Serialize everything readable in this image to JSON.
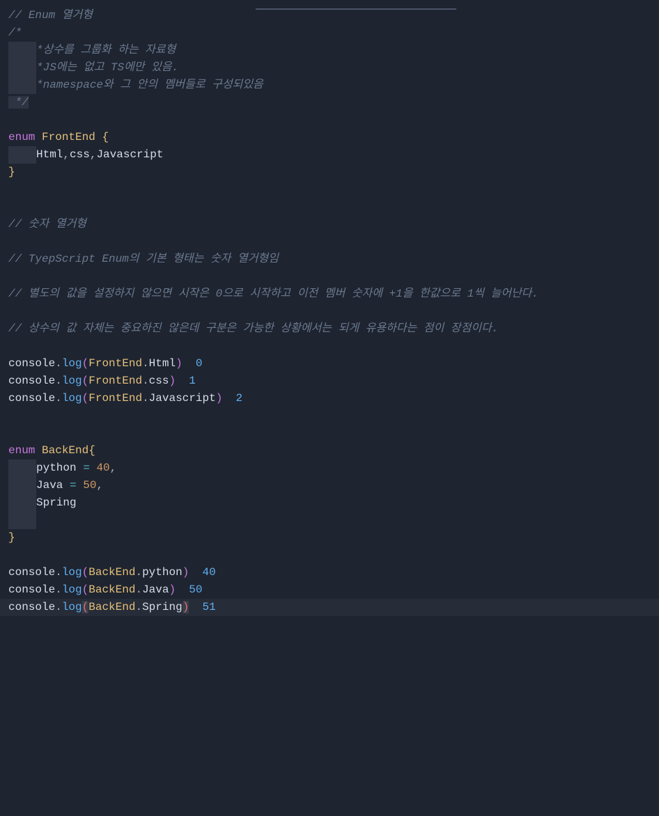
{
  "chart_data": null,
  "code": {
    "c1": "// Enum 열거형",
    "c2": "/*",
    "c3": "*상수를 그룹화 하는 자료형",
    "c4": "*JS에는 없고 TS에만 있음.",
    "c5": "*namespace와 그 안의 멤버들로 구성되있음",
    "c6": " */",
    "kw_enum": "enum",
    "enum1_name": "FrontEnd",
    "brace_open": "{",
    "brace_close": "}",
    "enum1_m1": "Html",
    "enum1_m2": "css",
    "enum1_m3": "Javascript",
    "comma": ",",
    "c7": "// 숫자 열거형",
    "c8": "// TyepScript Enum의 기본 형태는 숫자 열거형임",
    "c9": "// 별도의 값을 설정하지 않으면 시작은 0으로 시작하고 이전 멤버 숫자에 +1을 한값으로 1씩 늘어난다.",
    "c10": "// 상수의 값 자체는 중요하진 않은데 구분은 가능한 상황에서는 되게 유용하다는 점이 장점이다.",
    "console": "console",
    "dot": ".",
    "log": "log",
    "paren_open": "(",
    "paren_close": ")",
    "ref_FrontEnd": "FrontEnd",
    "ref_Html": "Html",
    "ref_css": "css",
    "ref_Javascript": "Javascript",
    "r1": "0",
    "r2": "1",
    "r3": "2",
    "enum2_name": "BackEnd",
    "enum2_m1": "python",
    "enum2_m2": "Java",
    "enum2_m3": "Spring",
    "eq": "=",
    "v40": "40",
    "v50": "50",
    "ref_BackEnd": "BackEnd",
    "ref_python": "python",
    "ref_Java": "Java",
    "ref_Spring": "Spring",
    "r4": "40",
    "r5": "50",
    "r6": "51"
  }
}
